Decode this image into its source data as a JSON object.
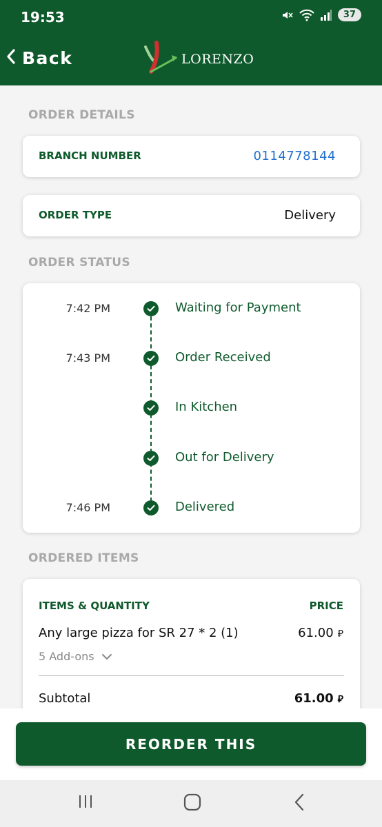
{
  "status_bar": {
    "time": "19:53",
    "battery": "37"
  },
  "header": {
    "back_label": "Back",
    "logo_text": "LORENZO"
  },
  "order_details": {
    "section_title": "ORDER DETAILS",
    "branch_label": "BRANCH NUMBER",
    "branch_value": "0114778144",
    "type_label": "ORDER TYPE",
    "type_value": "Delivery"
  },
  "order_status": {
    "section_title": "ORDER STATUS",
    "steps": [
      {
        "time": "7:42 PM",
        "label": "Waiting for Payment",
        "done": true
      },
      {
        "time": "7:43 PM",
        "label": "Order Received",
        "done": true
      },
      {
        "time": "",
        "label": "In Kitchen",
        "done": true
      },
      {
        "time": "",
        "label": "Out for Delivery",
        "done": true
      },
      {
        "time": "7:46 PM",
        "label": "Delivered",
        "done": true
      }
    ]
  },
  "ordered_items": {
    "section_title": "ORDERED ITEMS",
    "items_header": "ITEMS & QUANTITY",
    "price_header": "PRICE",
    "items": [
      {
        "name": "Any large pizza for SR 27 * 2 (1)",
        "price": "61.00",
        "addons": "5 Add-ons"
      }
    ],
    "currency_symbol": "⃁",
    "subtotal_label": "Subtotal",
    "subtotal_value": "61.00"
  },
  "actions": {
    "reorder_label": "REORDER THIS"
  },
  "colors": {
    "brand_green": "#0f5a2c",
    "link_blue": "#1f6fd1",
    "muted_gray": "#a9a9a9"
  }
}
